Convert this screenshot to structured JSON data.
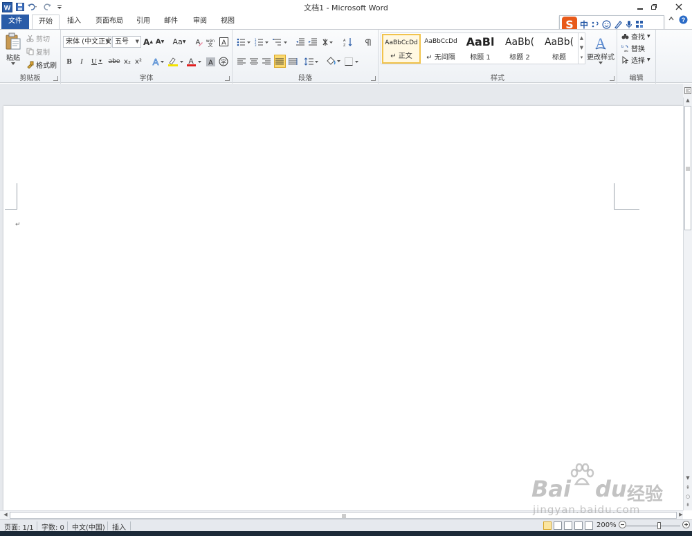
{
  "app": {
    "title": "文档1 - Microsoft Word"
  },
  "tabs": [
    {
      "label": "文件"
    },
    {
      "label": "开始"
    },
    {
      "label": "插入"
    },
    {
      "label": "页面布局"
    },
    {
      "label": "引用"
    },
    {
      "label": "邮件"
    },
    {
      "label": "审阅"
    },
    {
      "label": "视图"
    }
  ],
  "clipboard": {
    "paste": "粘贴",
    "cut": "剪切",
    "copy": "复制",
    "format_painter": "格式刷",
    "group_label": "剪贴板"
  },
  "font": {
    "font_name": "宋体 (中文正文)",
    "font_size": "五号",
    "group_label": "字体",
    "bold": "B",
    "italic": "I",
    "underline": "U",
    "strikethrough": "abe",
    "subscript": "x₂",
    "superscript": "x²",
    "grow": "A",
    "shrink": "A",
    "change_case": "Aa",
    "clear_format": "A",
    "char_border": "A",
    "char_shading": "A",
    "enclose": "字"
  },
  "paragraph": {
    "group_label": "段落"
  },
  "styles": {
    "group_label": "样式",
    "change_styles": "更改样式",
    "items": [
      {
        "sample": "AaBbCcDd",
        "name": "↵ 正文"
      },
      {
        "sample": "AaBbCcDd",
        "name": "↵ 无间隔"
      },
      {
        "sample": "AaBl",
        "name": "标题 1"
      },
      {
        "sample": "AaBb(",
        "name": "标题 2"
      },
      {
        "sample": "AaBb(",
        "name": "标题"
      }
    ]
  },
  "editing": {
    "group_label": "编辑",
    "find": "查找",
    "replace": "替换",
    "select": "选择"
  },
  "ime": {
    "logo": "S",
    "mode": "中"
  },
  "document": {
    "paragraph_mark": "↵"
  },
  "status": {
    "page": "页面: 1/1",
    "words": "字数: 0",
    "language": "中文(中国)",
    "mode": "插入",
    "zoom": "200%"
  },
  "watermark": {
    "brand": "Bai",
    "brand2": "du",
    "brand_cn": "经验",
    "url": "jingyan.baidu.com"
  },
  "colors": {
    "file_tab": "#2a5ca8",
    "highlight": "#f4e300",
    "font_color": "#e02020",
    "selected_style": "#f1c34c",
    "ime_logo": "#e85a1a"
  }
}
